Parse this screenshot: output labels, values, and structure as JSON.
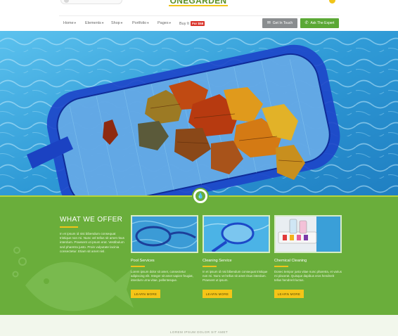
{
  "header": {
    "logo_text": "ONEGARDEN",
    "nav": [
      {
        "label": "Home",
        "caret": "▾"
      },
      {
        "label": "Elements",
        "caret": "▾"
      },
      {
        "label": "Shop",
        "caret": "▾"
      },
      {
        "label": "Portfolio",
        "caret": "▾"
      },
      {
        "label": "Pages",
        "caret": "▾"
      },
      {
        "label": "Buy It",
        "badge": "For $58"
      }
    ],
    "get_in_touch": "Get In Touch",
    "ask_expert": "Ask The Expert",
    "icons": {
      "get_in_touch": "envelope-icon",
      "ask_expert": "chat-icon",
      "emblem": "water-drop-icon"
    }
  },
  "offer": {
    "title": "WHAT WE OFFER",
    "text": "In et ipsum id nisi bibendum consequat tristique non mi. Nunc vel tellus sit amet risus interdum. Praesent ut ipsum erat. Vestibulum sed pharetra justo. Proin vulputate lacinia consectetur. Etiam sit amet nisl.",
    "cards": [
      {
        "title": "Pool Services",
        "text": "Lorem ipsum dolor sit amet, consectetur adipiscing elit. Integer sit amet sapien feugiat, interdum urna vitae, pellentesque.",
        "button": "LEARN MORE"
      },
      {
        "title": "Cleaning Service",
        "text": "In et ipsum id nisi bibendum consequat tristique non mi. Nunc vel tellus sit amet risus interdum. Praesent ut ipsum.",
        "button": "LEARN MORE"
      },
      {
        "title": "Chemical Cleaning",
        "text": "Donec tempor justo vitae nunc pharetra, et varius mi placerat. Quisque dapibus eros hendrerit tellus hendrerit luctus.",
        "button": "LEARN MORE"
      }
    ]
  },
  "footer": {
    "text": "LOREM IPSUM DOLOR SIT AMET"
  },
  "colors": {
    "brand_green": "#6aae3b",
    "accent_yellow": "#f5c518",
    "button_gray": "#8a8d8f",
    "button_green": "#5ba835",
    "badge_red": "#d9342b"
  }
}
